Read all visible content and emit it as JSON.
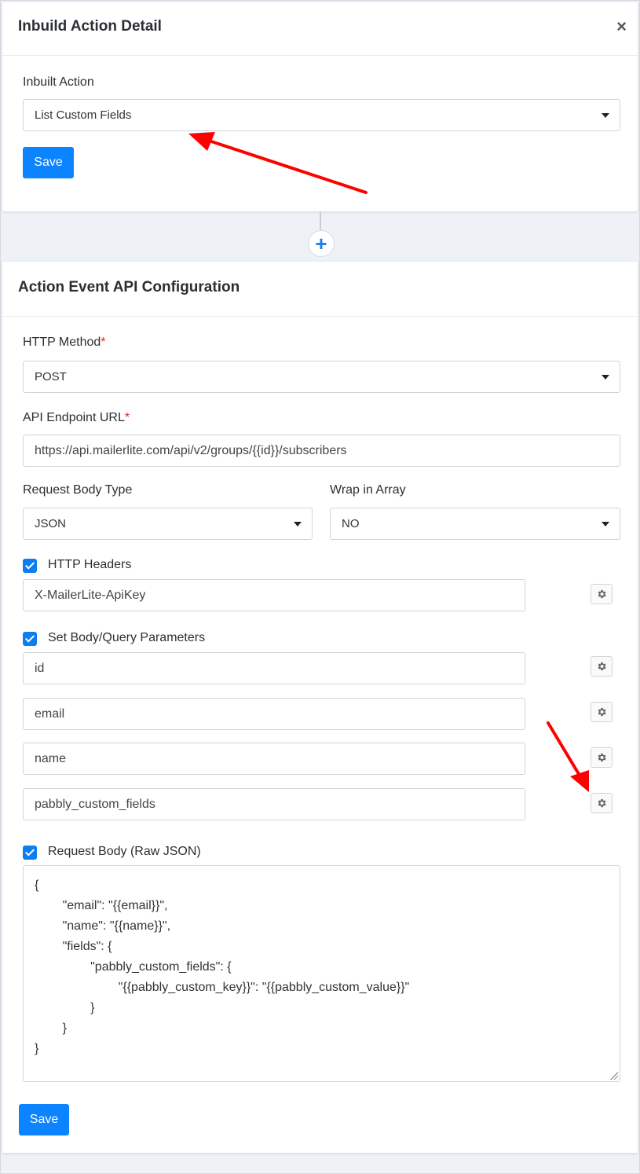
{
  "inbuild_card": {
    "title": "Inbuild Action Detail",
    "close_label": "×",
    "inbuilt_action_label": "Inbuilt Action",
    "inbuilt_action_value": "List Custom Fields",
    "save_label": "Save"
  },
  "add_step": {
    "label": "+"
  },
  "api_card": {
    "title": "Action Event API Configuration",
    "http_method_label": "HTTP Method",
    "required_marker": "*",
    "http_method_value": "POST",
    "endpoint_label": "API Endpoint URL",
    "endpoint_value": "https://api.mailerlite.com/api/v2/groups/{{id}}/subscribers",
    "body_type_label": "Request Body Type",
    "body_type_value": "JSON",
    "wrap_label": "Wrap in Array",
    "wrap_value": "NO",
    "headers_label": "HTTP Headers",
    "headers": [
      "X-MailerLite-ApiKey"
    ],
    "params_label": "Set Body/Query Parameters",
    "params": [
      "id",
      "email",
      "name",
      "pabbly_custom_fields"
    ],
    "raw_body_label": "Request Body (Raw JSON)",
    "raw_body_lines": [
      "{",
      "        \"email\": \"{{email}}\",",
      "        \"name\": \"{{name}}\",",
      "        \"fields\": {",
      "                \"pabbly_custom_fields\": {",
      "                        \"{{pabbly_custom_key}}\": \"{{pabbly_custom_value}}\"",
      "                }",
      "        }",
      "}"
    ],
    "save_label": "Save"
  },
  "colors": {
    "primary": "#0d84ff",
    "required": "#e02424",
    "annotation_arrow": "#ff0000"
  }
}
